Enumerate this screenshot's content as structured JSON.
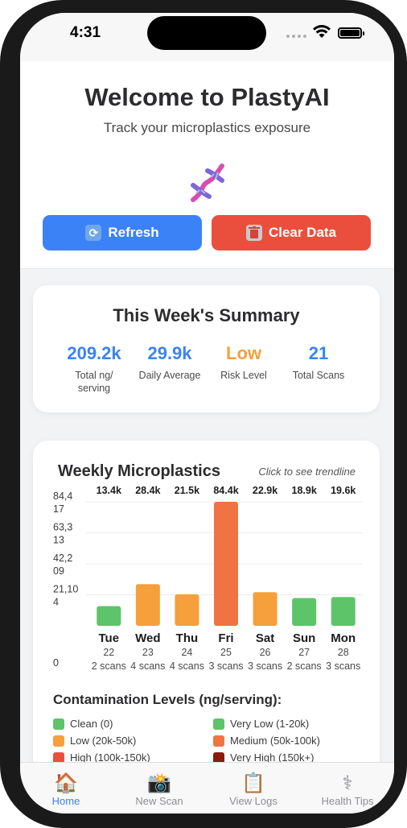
{
  "status_bar": {
    "time": "4:31"
  },
  "header": {
    "title": "Welcome to PlastyAI",
    "subtitle": "Track your microplastics exposure",
    "logo_icon": "dna-icon",
    "refresh_label": "Refresh",
    "clear_label": "Clear Data"
  },
  "summary": {
    "title": "This Week's Summary",
    "stats": [
      {
        "value": "209.2k",
        "label": "Total ng/ serving",
        "color": "#3b82f6"
      },
      {
        "value": "29.9k",
        "label": "Daily Average",
        "color": "#3b82f6"
      },
      {
        "value": "Low",
        "label": "Risk Level",
        "color": "#f5a03a"
      },
      {
        "value": "21",
        "label": "Total Scans",
        "color": "#3b82f6"
      }
    ]
  },
  "weekly_chart": {
    "title": "Weekly Microplastics",
    "hint": "Click to see trendline"
  },
  "chart_data": {
    "type": "bar",
    "title": "Weekly Microplastics",
    "categories": [
      "Tue",
      "Wed",
      "Thu",
      "Fri",
      "Sat",
      "Sun",
      "Mon"
    ],
    "dates": [
      "22",
      "23",
      "24",
      "25",
      "26",
      "27",
      "28"
    ],
    "scans": [
      "2 scans",
      "4 scans",
      "4 scans",
      "3 scans",
      "3 scans",
      "2 scans",
      "3 scans"
    ],
    "value_labels": [
      "13.4k",
      "28.4k",
      "21.5k",
      "84.4k",
      "22.9k",
      "18.9k",
      "19.6k"
    ],
    "values": [
      13400,
      28400,
      21500,
      84400,
      22900,
      18900,
      19600
    ],
    "colors": [
      "#5ec46a",
      "#f5a03a",
      "#f5a03a",
      "#f07443",
      "#f5a03a",
      "#5ec46a",
      "#5ec46a"
    ],
    "y_ticks": [
      {
        "value": 84417,
        "label_lines": [
          "84,4",
          "17"
        ]
      },
      {
        "value": 63313,
        "label_lines": [
          "63,3",
          "13"
        ]
      },
      {
        "value": 42209,
        "label_lines": [
          "42,2",
          "09"
        ]
      },
      {
        "value": 21104,
        "label_lines": [
          "21,10",
          "4"
        ]
      },
      {
        "value": 0,
        "label_lines": [
          "0"
        ]
      }
    ],
    "ylim": [
      0,
      84417
    ],
    "grid": true
  },
  "legend": {
    "title": "Contamination Levels (ng/serving):",
    "items": [
      {
        "label": "Clean (0)",
        "color": "#5ec46a"
      },
      {
        "label": "Very Low (1-20k)",
        "color": "#5ec46a"
      },
      {
        "label": "Low (20k-50k)",
        "color": "#f5a03a"
      },
      {
        "label": "Medium (50k-100k)",
        "color": "#f07443"
      },
      {
        "label": "High (100k-150k)",
        "color": "#ea4f3d"
      },
      {
        "label": "Very High (150k+)",
        "color": "#8b1a0f"
      }
    ]
  },
  "tabs": [
    {
      "label": "Home",
      "icon": "house-icon",
      "glyph": "🏠",
      "active": true
    },
    {
      "label": "New Scan",
      "icon": "camera-icon",
      "glyph": "📸",
      "active": false
    },
    {
      "label": "View Logs",
      "icon": "clipboard-icon",
      "glyph": "📋",
      "active": false
    },
    {
      "label": "Health Tips",
      "icon": "caduceus-icon",
      "glyph": "⚕",
      "active": false
    }
  ]
}
